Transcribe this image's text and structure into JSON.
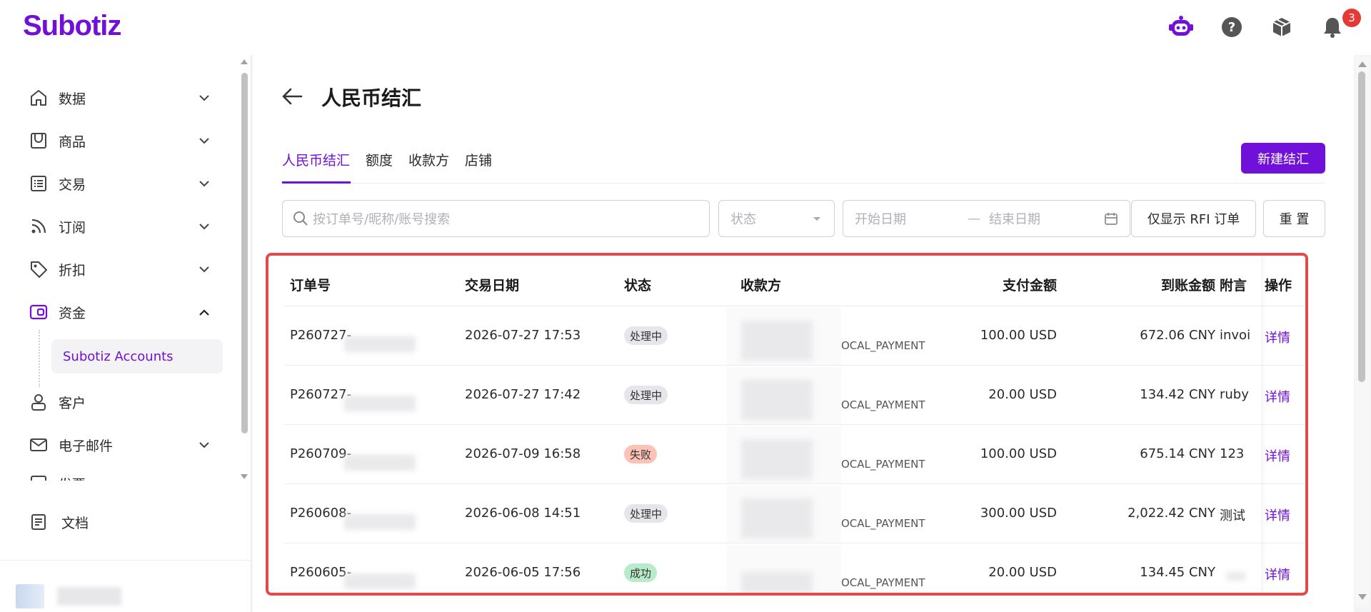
{
  "brand": {
    "name": "Subotiz",
    "color": "#7010d8"
  },
  "header": {
    "icons": [
      "robot-assistant-icon",
      "help-icon",
      "package-icon",
      "bell-icon"
    ],
    "notification_count": "3"
  },
  "sidebar": {
    "items": [
      {
        "label": "数据",
        "icon": "home-icon",
        "expanded": false
      },
      {
        "label": "商品",
        "icon": "shop-icon",
        "expanded": false
      },
      {
        "label": "交易",
        "icon": "list-icon",
        "expanded": false
      },
      {
        "label": "订阅",
        "icon": "rss-icon",
        "expanded": false
      },
      {
        "label": "折扣",
        "icon": "tag-icon",
        "expanded": false
      },
      {
        "label": "资金",
        "icon": "wallet-icon",
        "expanded": true
      },
      {
        "label": "客户",
        "icon": "user-icon",
        "expanded": false
      },
      {
        "label": "电子邮件",
        "icon": "mail-icon",
        "expanded": false
      },
      {
        "label": "发票",
        "icon": "invoice-icon",
        "expanded": false
      }
    ],
    "sub_item": "Subotiz Accounts",
    "docs": "文档"
  },
  "page": {
    "title": "人民币结汇",
    "tabs": [
      "人民币结汇",
      "额度",
      "收款方",
      "店铺"
    ],
    "active_tab": 0,
    "new_button": "新建结汇"
  },
  "filters": {
    "search_placeholder": "按订单号/昵称/账号搜索",
    "status_placeholder": "状态",
    "start_date": "开始日期",
    "date_sep": "—",
    "end_date": "结束日期",
    "rfi_button": "仅显示 RFI 订单",
    "reset_button": "重 置"
  },
  "table": {
    "columns": [
      "订单号",
      "交易日期",
      "状态",
      "收款方",
      "支付金额",
      "到账金额",
      "附言",
      "操作"
    ],
    "rows": [
      {
        "order": "P260727-",
        "date": "2026-07-27 17:53",
        "status": "处理中",
        "status_type": "processing",
        "method": "OCAL_PAYMENT",
        "pay": "100.00 USD",
        "recv": "672.06 CNY",
        "note": "invoi",
        "action": "详情"
      },
      {
        "order": "P260727-",
        "date": "2026-07-27 17:42",
        "status": "处理中",
        "status_type": "processing",
        "method": "OCAL_PAYMENT",
        "pay": "20.00 USD",
        "recv": "134.42 CNY",
        "note": "ruby",
        "action": "详情"
      },
      {
        "order": "P260709-",
        "date": "2026-07-09 16:58",
        "status": "失败",
        "status_type": "failed",
        "method": "OCAL_PAYMENT",
        "pay": "100.00 USD",
        "recv": "675.14 CNY",
        "note": "123",
        "action": "详情"
      },
      {
        "order": "P260608-",
        "date": "2026-06-08 14:51",
        "status": "处理中",
        "status_type": "processing",
        "method": "OCAL_PAYMENT",
        "pay": "300.00 USD",
        "recv": "2,022.42 CNY",
        "note": "测试",
        "action": "详情"
      },
      {
        "order": "P260605-",
        "date": "2026-06-05 17:56",
        "status": "成功",
        "status_type": "success",
        "method": "OCAL_PAYMENT",
        "pay": "20.00 USD",
        "recv": "134.45 CNY",
        "note": "",
        "action": "详情"
      }
    ]
  }
}
